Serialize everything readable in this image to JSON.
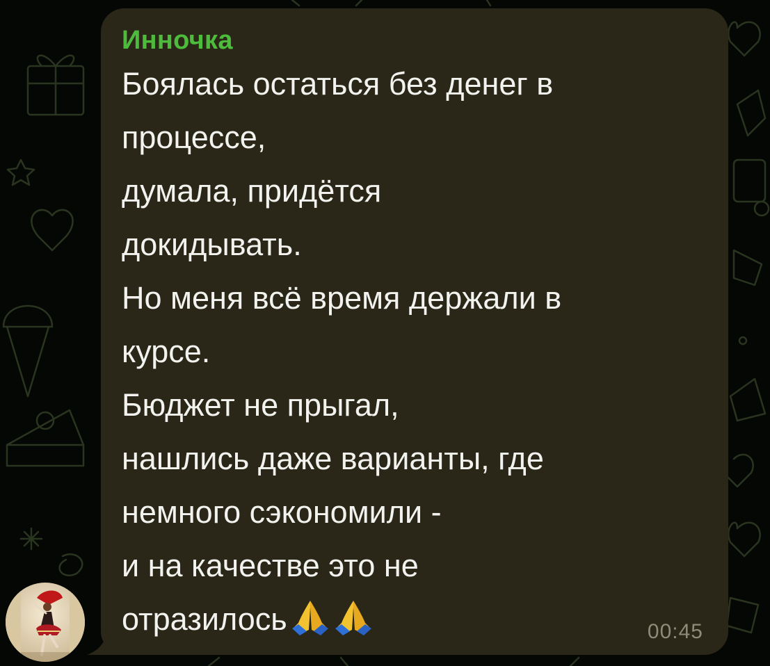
{
  "chat": {
    "message": {
      "sender": "Инночка",
      "lines": [
        "Боялась остаться без денег в",
        "процессе,",
        "думала, придётся",
        "докидывать.",
        "Но меня всё время держали в",
        "курсе.",
        "Бюджет не прыгал,",
        "нашлись даже варианты, где",
        "немного сэкономили -",
        "и на качестве это не",
        "отразилось"
      ],
      "trailing_emojis": [
        "folded-hands-icon",
        "folded-hands-icon"
      ],
      "time": "00:45"
    },
    "avatar_icon": "user-avatar-photo",
    "colors": {
      "background": "#050705",
      "bubble": "#2a2718",
      "sender_name": "#4dbb3c",
      "text": "#f2f2ee",
      "timestamp": "#8f8b7a"
    }
  }
}
